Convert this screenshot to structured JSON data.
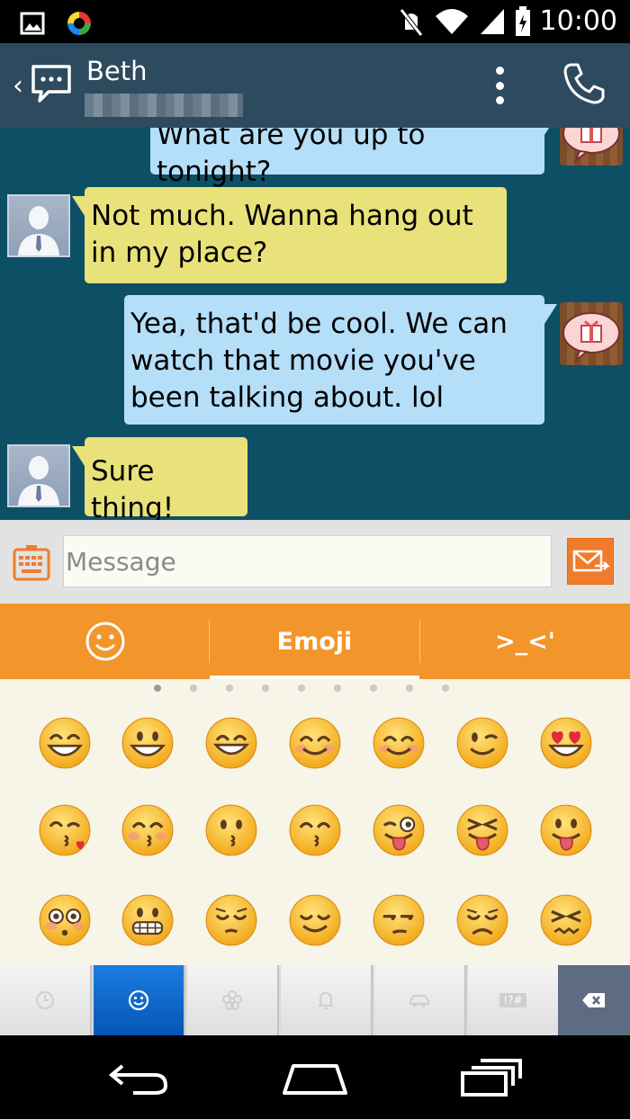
{
  "status_bar": {
    "time": "10:00",
    "icons": [
      "gallery-icon",
      "sync-app-icon",
      "mute-icon",
      "wifi-icon",
      "signal-icon",
      "battery-icon"
    ]
  },
  "header": {
    "back_glyph": "‹",
    "contact_name": "Beth",
    "contact_number_blurred": true,
    "icons": [
      "messages-app-icon",
      "overflow-menu-icon",
      "phone-icon"
    ]
  },
  "messages": [
    {
      "direction": "out",
      "lines": [
        "What are you up to tonight?"
      ],
      "avatar": "gift-avatar"
    },
    {
      "direction": "in",
      "lines": [
        "Not much. Wanna hang out",
        "in my place?"
      ],
      "avatar": "person-avatar"
    },
    {
      "direction": "out",
      "lines": [
        "Yea, that'd be cool. We can",
        "watch that movie you've",
        "been talking about. lol"
      ],
      "avatar": "gift-avatar"
    },
    {
      "direction": "in",
      "lines": [
        "Sure thing!"
      ],
      "avatar": "person-avatar"
    }
  ],
  "compose": {
    "placeholder": "Message",
    "value": ""
  },
  "emoji_tabs": {
    "smiley_icon": "smiley-icon",
    "emoji_label": "Emoji",
    "emoticon_label": ">_<'",
    "selected": "Emoji"
  },
  "emoji_pages": {
    "count": 9,
    "current": 1
  },
  "emoji_grid": [
    [
      "grinning",
      "grinning-big",
      "grinning-squint",
      "smiling-blush",
      "relaxed",
      "winking",
      "heart-eyes"
    ],
    [
      "kissing-heart",
      "kissing-blush",
      "kissing",
      "kissing-smiling-eyes",
      "tongue-wink",
      "tongue-squint",
      "tongue"
    ],
    [
      "flushed",
      "grimacing",
      "pensive",
      "relieved",
      "unamused",
      "disappointed",
      "confounded"
    ]
  ],
  "category_bar": {
    "keys": [
      "recent-icon",
      "smiley-category-icon",
      "flower-icon",
      "bell-icon",
      "car-icon",
      "symbols-icon",
      "backspace-icon"
    ],
    "symbols_label": "!?#",
    "selected": 1
  },
  "colors": {
    "action_bar": "#2e4a5e",
    "conversation_bg": "#0d5066",
    "outgoing_bubble": "#b5def8",
    "incoming_bubble": "#e9e27a",
    "accent": "#f2952a",
    "selected_category": "#1a7de0"
  }
}
